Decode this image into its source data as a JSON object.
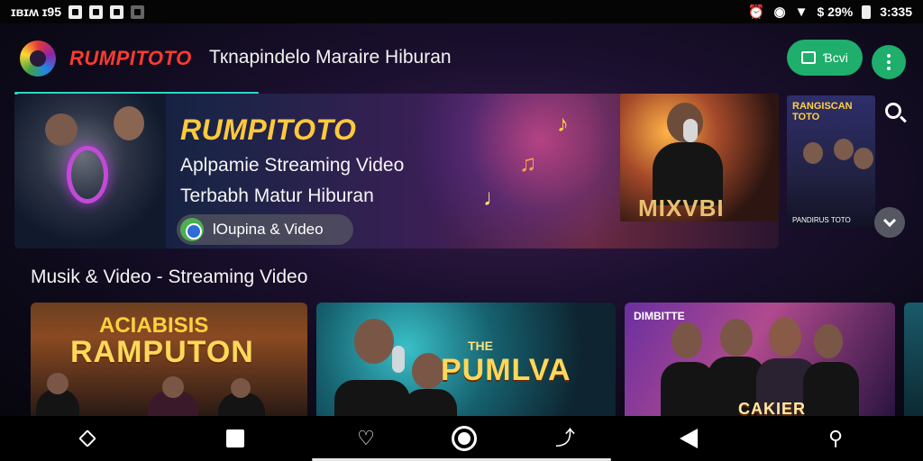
{
  "status_bar": {
    "left_text": "ɪвɪʍ ɪ95",
    "right_text": "$ 29%",
    "time": "3:335",
    "icons": [
      "notification-icon",
      "camera-icon",
      "app-icon",
      "image-icon",
      "alarm-icon",
      "wifi-icon",
      "signal-icon",
      "battery-icon"
    ]
  },
  "header": {
    "brand": "RUMPITOTO",
    "tagline": "Ткnapindelo Maraire Hiburan",
    "action_label": "Ɓcvi",
    "colors": {
      "brand": "#ff3b30",
      "accent": "#1fae6b"
    }
  },
  "hero": {
    "title": "RUMPITOTO",
    "line1": "Aplpamie Streaming Video",
    "line2": "Terbabh Matur Hiburan",
    "chip_label": "lOupina & Video",
    "side_label": "MIXVBI",
    "thumb_title": "RANGISCAN TOTO",
    "thumb_caption": "PANDIRUS TOTO",
    "progress": 0.32
  },
  "section": {
    "title": "Musik & Video - Streaming Video",
    "cards": [
      {
        "kicker": "ACIABISIS",
        "title": "RAMPUTON"
      },
      {
        "kicker": "THE",
        "title": "PUMLVA"
      },
      {
        "kicker": "DIMBITTE",
        "title": "CAKIER"
      }
    ]
  },
  "nav": {
    "icons": [
      "diamond-icon",
      "square-icon",
      "heart-icon",
      "home-icon",
      "share-icon",
      "back-icon",
      "key-icon"
    ]
  }
}
